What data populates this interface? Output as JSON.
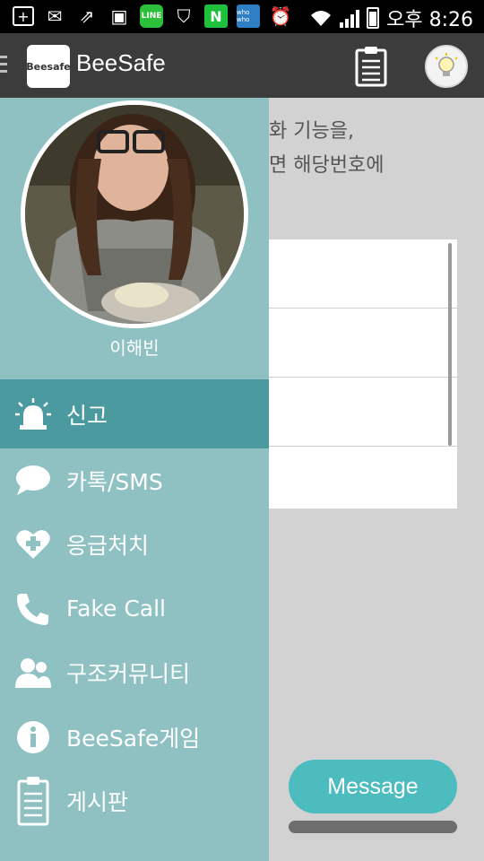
{
  "status_bar": {
    "time": "오후 8:26",
    "icons": [
      "add-icon",
      "mail-icon",
      "share-icon",
      "image-icon",
      "line-app-icon",
      "shield-icon",
      "naver-icon",
      "whowho-icon",
      "alarm-icon",
      "wifi-icon",
      "signal-icon",
      "battery-icon"
    ],
    "line_label": "LINE",
    "naver_label": "N",
    "whowho_label": "who who"
  },
  "app_bar": {
    "logo_text": "Beesafe",
    "title": "BeeSafe"
  },
  "main": {
    "text_lines": [
      "화 기능을,",
      "면 해당번호에"
    ],
    "message_button": "Message"
  },
  "drawer": {
    "profile_name": "이해빈",
    "menu": [
      {
        "label": "신고",
        "icon": "siren-icon",
        "active": true
      },
      {
        "label": "카톡/SMS",
        "icon": "chat-bubble-icon"
      },
      {
        "label": "응급처치",
        "icon": "heart-plus-icon"
      },
      {
        "label": "Fake Call",
        "icon": "phone-icon"
      },
      {
        "label": "구조커뮤니티",
        "icon": "people-icon"
      },
      {
        "label": "BeeSafe게임",
        "icon": "info-icon"
      },
      {
        "label": "게시판",
        "icon": "clipboard-icon"
      }
    ]
  },
  "colors": {
    "drawer_bg": "#8fc1c2",
    "drawer_active": "#4a9aa0",
    "app_bar": "#3c3c3c",
    "message_button": "#4cbcbf"
  }
}
